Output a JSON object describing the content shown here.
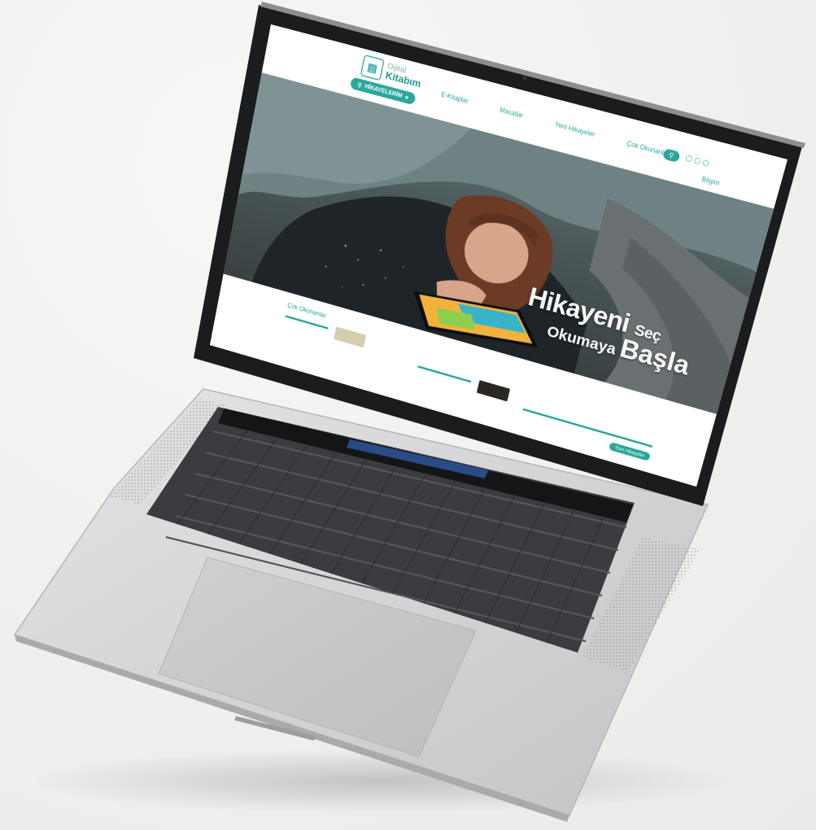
{
  "site": {
    "logo_top": "Dijital",
    "logo_bottom": "Kitabım",
    "search_pill_label": "HİKAYELERİM",
    "nav": [
      "E-Kitaplar",
      "Masallar",
      "Yeni Hikayeler",
      "Çok Okunanlar"
    ],
    "nav_second_row": "Bilgim",
    "section_label": "Çok Okunanlar",
    "more_button": "Tüm Hikayeler"
  },
  "hero": {
    "line1_big": "Hikayeni",
    "line1_small": "Seç",
    "line2_small": "Okumaya",
    "line2_big": "Başla"
  },
  "colors": {
    "accent": "#2aa79b",
    "laptop_body": "#d6d7d9",
    "background": "#f0f0ee"
  },
  "icons": {
    "search": "search-icon",
    "social": "social-icon",
    "logo": "book-logo-icon"
  }
}
